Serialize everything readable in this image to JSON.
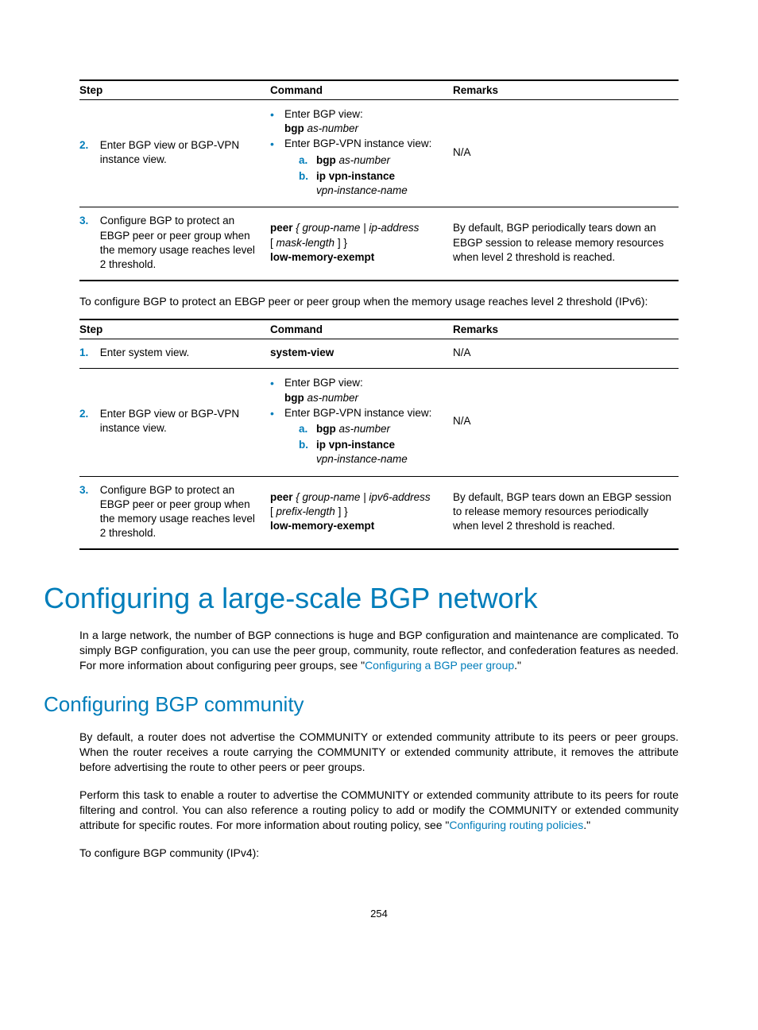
{
  "table1": {
    "headers": {
      "step": "Step",
      "command": "Command",
      "remarks": "Remarks"
    },
    "rows": [
      {
        "num": "2.",
        "step": "Enter BGP view or BGP-VPN instance view.",
        "cmd_b1_label": "Enter BGP view:",
        "cmd_b1_kw": "bgp",
        "cmd_b1_arg": " as-number",
        "cmd_b2_label": "Enter BGP-VPN instance view:",
        "cmd_b2a_lbl": "a.",
        "cmd_b2a_kw": "bgp",
        "cmd_b2a_arg": " as-number",
        "cmd_b2b_lbl": "b.",
        "cmd_b2b_kw": "ip vpn-instance",
        "cmd_b2b_arg": "vpn-instance-name",
        "remarks": "N/A"
      },
      {
        "num": "3.",
        "step": "Configure BGP to protect an EBGP peer or peer group when the memory usage reaches level 2 threshold.",
        "cmd_l1_kw": "peer",
        "cmd_l1_rest": " { group-name | ip-address",
        "cmd_l2_a": "[ ",
        "cmd_l2_it": "mask-length",
        "cmd_l2_b": " ] }",
        "cmd_l3": "low-memory-exempt",
        "remarks": "By default, BGP periodically tears down an EBGP session to release memory resources when level 2 threshold is reached."
      }
    ]
  },
  "intro2": "To configure BGP to protect an EBGP peer or peer group when the memory usage reaches level 2 threshold (IPv6):",
  "table2": {
    "headers": {
      "step": "Step",
      "command": "Command",
      "remarks": "Remarks"
    },
    "rows": [
      {
        "num": "1.",
        "step": "Enter system view.",
        "cmd": "system-view",
        "remarks": "N/A"
      },
      {
        "num": "2.",
        "step": "Enter BGP view or BGP-VPN instance view.",
        "cmd_b1_label": "Enter BGP view:",
        "cmd_b1_kw": "bgp",
        "cmd_b1_arg": " as-number",
        "cmd_b2_label": "Enter BGP-VPN instance view:",
        "cmd_b2a_lbl": "a.",
        "cmd_b2a_kw": "bgp",
        "cmd_b2a_arg": " as-number",
        "cmd_b2b_lbl": "b.",
        "cmd_b2b_kw": "ip vpn-instance",
        "cmd_b2b_arg": "vpn-instance-name",
        "remarks": "N/A"
      },
      {
        "num": "3.",
        "step": "Configure BGP to protect an EBGP peer or peer group when the memory usage reaches level 2 threshold.",
        "cmd_l1_kw": "peer",
        "cmd_l1_rest": " { group-name | ipv6-address",
        "cmd_l2_a": "[ ",
        "cmd_l2_it": "prefix-length",
        "cmd_l2_b": " ] }",
        "cmd_l3": "low-memory-exempt",
        "remarks": "By default, BGP tears down an EBGP session to release memory resources periodically when level 2 threshold is reached."
      }
    ]
  },
  "h1": "Configuring a large-scale BGP network",
  "p1a": "In a large network, the number of BGP connections is huge and BGP configuration and maintenance are complicated. To simply BGP configuration, you can use the peer group, community, route reflector, and confederation features as needed. For more information about configuring peer groups, see \"",
  "p1link": "Configuring a BGP peer group",
  "p1b": ".\"",
  "h2": "Configuring BGP community",
  "p2": "By default, a router does not advertise the COMMUNITY or extended community attribute to its peers or peer groups. When the router receives a route carrying the COMMUNITY or extended community attribute, it removes the attribute before advertising the route to other peers or peer groups.",
  "p3a": "Perform this task to enable a router to advertise the COMMUNITY or extended community attribute to its peers for route filtering and control. You can also reference a routing policy to add or modify the COMMUNITY or extended community attribute for specific routes. For more information about routing policy, see \"",
  "p3link": "Configuring routing policies",
  "p3b": ".\"",
  "p4": "To configure BGP community (IPv4):",
  "pageno": "254"
}
